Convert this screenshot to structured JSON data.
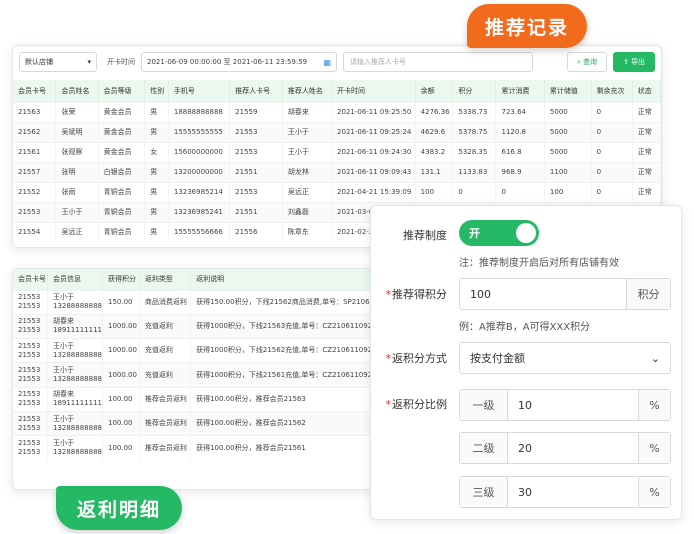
{
  "records": {
    "filters": {
      "store_select": "默认店铺",
      "open_time_label": "开卡时间",
      "date_range": "2021-06-09 00:00:00 至 2021-06-11 23:59:59",
      "search_placeholder": "请输入推荐人卡号",
      "query_button": "查询",
      "export_button": "导出"
    },
    "columns": [
      "会员卡号",
      "会员姓名",
      "会员等级",
      "性别",
      "手机号",
      "推荐人卡号",
      "推荐人姓名",
      "开卡时间",
      "余额",
      "积分",
      "累计消费",
      "累计储值",
      "剩余充次",
      "状态"
    ],
    "rows": [
      [
        "21563",
        "张荣",
        "黄金会员",
        "男",
        "18888888888",
        "21559",
        "胡春来",
        "2021-06-11 09:25:50",
        "4276.36",
        "5338.73",
        "723.64",
        "5000",
        "0",
        "正常"
      ],
      [
        "21562",
        "吴斌明",
        "黄金会员",
        "男",
        "15555555555",
        "21553",
        "王小于",
        "2021-06-11 09:25:24",
        "4629.6",
        "5378.75",
        "1120.8",
        "5000",
        "0",
        "正常"
      ],
      [
        "21561",
        "张观察",
        "黄金会员",
        "女",
        "15600000000",
        "21553",
        "王小于",
        "2021-06-11 09:24:30",
        "4383.2",
        "5328.35",
        "616.8",
        "5000",
        "0",
        "正常"
      ],
      [
        "21557",
        "张明",
        "白银会员",
        "男",
        "13200000000",
        "21551",
        "胡龙林",
        "2021-06-11 09:09:43",
        "131.1",
        "1133.83",
        "968.9",
        "1100",
        "0",
        "正常"
      ],
      [
        "21552",
        "张雨",
        "青铜会员",
        "男",
        "13236985214",
        "21553",
        "吴远正",
        "2021-04-21 15:39:09",
        "100",
        "0",
        "0",
        "100",
        "0",
        "正常"
      ],
      [
        "21553",
        "王小于",
        "青铜会员",
        "男",
        "13236985241",
        "21551",
        "刘鑫磊",
        "2021-03-0",
        "",
        "",
        "",
        "",
        "",
        ""
      ],
      [
        "21554",
        "吴远正",
        "青铜会员",
        "男",
        "15555556666",
        "21556",
        "陈章东",
        "2021-02-2",
        "",
        "",
        "",
        "",
        "",
        ""
      ]
    ]
  },
  "rebate": {
    "columns": [
      "会员卡号",
      "会员信息",
      "获得积分",
      "返利类型",
      "返利说明"
    ],
    "rows": [
      {
        "cards": [
          "21553",
          "21553"
        ],
        "info": [
          "王小于",
          "13288888888"
        ],
        "points": "150.00",
        "type": "商品消费返利",
        "desc": "获得150.00积分，下线21562商品消费,单号：SP21061109"
      },
      {
        "cards": [
          "21553",
          "21553"
        ],
        "info": [
          "胡春来",
          "18911111111"
        ],
        "points": "1000.00",
        "type": "充值返利",
        "desc": "获得1000积分，下线21563充值,单号：CZ2106110926524"
      },
      {
        "cards": [
          "21553",
          "21553"
        ],
        "info": [
          "王小于",
          "13288888888"
        ],
        "points": "1000.00",
        "type": "充值返利",
        "desc": "获得1000积分，下线21562充值,单号：CZ21061109262"
      },
      {
        "cards": [
          "21553",
          "21553"
        ],
        "info": [
          "王小于",
          "13288888888"
        ],
        "points": "1000.00",
        "type": "充值返利",
        "desc": "获得1000积分，下线21561充值,单号：CZ21061109262"
      },
      {
        "cards": [
          "21553",
          "21553"
        ],
        "info": [
          "胡春来",
          "18911111111"
        ],
        "points": "100.00",
        "type": "推荐会员返利",
        "desc": "获得100.00积分，推荐会员21563"
      },
      {
        "cards": [
          "21553",
          "21553"
        ],
        "info": [
          "王小于",
          "13288888888"
        ],
        "points": "100.00",
        "type": "推荐会员返利",
        "desc": "获得100.00积分，推荐会员21562"
      },
      {
        "cards": [
          "21553",
          "21553"
        ],
        "info": [
          "王小于",
          "13288888888"
        ],
        "points": "100.00",
        "type": "推荐会员返利",
        "desc": "获得100.00积分，推荐会员21561"
      }
    ]
  },
  "tags": {
    "recommend": "推荐记录",
    "rebate": "返利明细"
  },
  "settings": {
    "system_label": "推荐制度",
    "toggle_text": "开",
    "system_note": "注：推荐制度开启后对所有店铺有效",
    "points_label": "推荐得积分",
    "points_value": "100",
    "points_unit": "积分",
    "points_example": "例：A推荐B，A可得XXX积分",
    "method_label": "返积分方式",
    "method_value": "按支付金额",
    "ratio_label": "返积分比例",
    "levels": [
      {
        "name": "一级",
        "value": "10",
        "unit": "%"
      },
      {
        "name": "二级",
        "value": "20",
        "unit": "%"
      },
      {
        "name": "三级",
        "value": "30",
        "unit": "%"
      }
    ],
    "colors": {
      "accent_green": "#25b865",
      "accent_orange": "#f26a1b"
    }
  }
}
